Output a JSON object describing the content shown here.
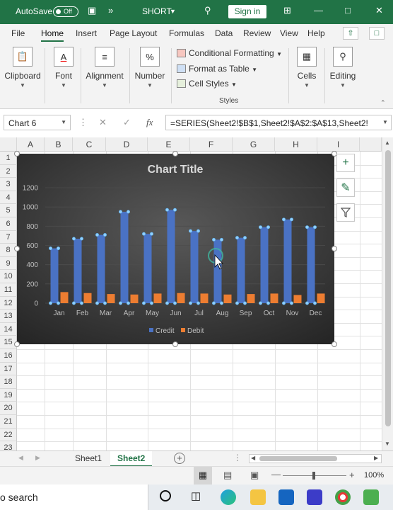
{
  "titlebar": {
    "autosave_label": "AutoSave",
    "autosave_state": "Off",
    "doc_name": "SHORT",
    "sign_in": "Sign in",
    "more": "»"
  },
  "tabs": [
    "File",
    "Home",
    "Insert",
    "Page Layout",
    "Formulas",
    "Data",
    "Review",
    "View",
    "Help"
  ],
  "ribbon": {
    "clipboard": "Clipboard",
    "font": "Font",
    "alignment": "Alignment",
    "number": "Number",
    "number_icon": "%",
    "conditional": "Conditional Formatting",
    "format_table": "Format as Table",
    "cell_styles": "Cell Styles",
    "styles_group": "Styles",
    "cells": "Cells",
    "editing": "Editing"
  },
  "formula_bar": {
    "name_box": "Chart 6",
    "fx": "fx",
    "formula": "=SERIES(Sheet2!$B$1,Sheet2!$A$2:$A$13,Sheet2!"
  },
  "columns": [
    "A",
    "B",
    "C",
    "D",
    "E",
    "F",
    "G",
    "H",
    "I"
  ],
  "rows": [
    "1",
    "2",
    "3",
    "4",
    "5",
    "6",
    "7",
    "8",
    "9",
    "10",
    "11",
    "12",
    "13",
    "14",
    "15",
    "16",
    "17",
    "18",
    "19",
    "20",
    "21",
    "22",
    "23"
  ],
  "chart_data": {
    "type": "bar",
    "title": "Chart Title",
    "categories": [
      "Jan",
      "Feb",
      "Mar",
      "Apr",
      "May",
      "Jun",
      "Jul",
      "Aug",
      "Sep",
      "Oct",
      "Nov",
      "Dec"
    ],
    "series": [
      {
        "name": "Credit",
        "values": [
          570,
          670,
          710,
          950,
          720,
          970,
          750,
          660,
          680,
          790,
          870,
          790
        ],
        "color": "#4a72c4"
      },
      {
        "name": "Debit",
        "values": [
          115,
          105,
          95,
          90,
          100,
          105,
          100,
          90,
          95,
          100,
          85,
          100
        ],
        "color": "#ed7d31"
      }
    ],
    "ylim": [
      0,
      1200
    ],
    "yticks": [
      "0",
      "200",
      "400",
      "600",
      "800",
      "1000",
      "1200"
    ],
    "grid": true,
    "legend": "bottom"
  },
  "sheets": {
    "tab1": "Sheet1",
    "tab2": "Sheet2"
  },
  "status": {
    "zoom": "100%"
  },
  "taskbar": {
    "search": "o search"
  }
}
